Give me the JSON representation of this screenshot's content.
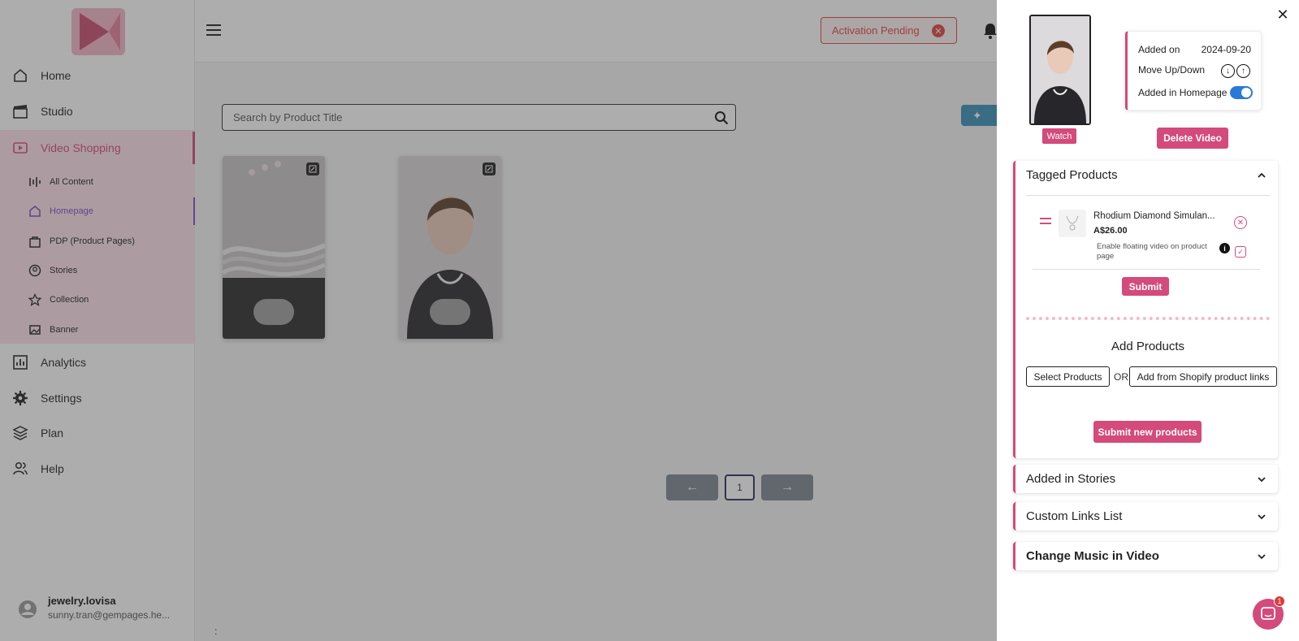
{
  "sidebar": {
    "items": [
      {
        "label": "Home",
        "icon": "home-icon"
      },
      {
        "label": "Studio",
        "icon": "clapperboard-icon"
      },
      {
        "label": "Video Shopping",
        "icon": "video-icon"
      },
      {
        "label": "Analytics",
        "icon": "bar-chart-icon"
      },
      {
        "label": "Settings",
        "icon": "gear-icon"
      },
      {
        "label": "Plan",
        "icon": "layers-icon"
      },
      {
        "label": "Help",
        "icon": "users-icon"
      }
    ],
    "sub_items": [
      {
        "label": "All Content",
        "icon": "sliders-icon"
      },
      {
        "label": "Homepage",
        "icon": "home-icon"
      },
      {
        "label": "PDP (Product Pages)",
        "icon": "bag-icon"
      },
      {
        "label": "Stories",
        "icon": "user-circle-icon"
      },
      {
        "label": "Collection",
        "icon": "star-icon"
      },
      {
        "label": "Banner",
        "icon": "image-icon"
      }
    ],
    "user": {
      "name": "jewelry.lovisa",
      "email": "sunny.tran@gempages.he..."
    }
  },
  "header": {
    "activation_label": "Activation Pending"
  },
  "main": {
    "search_placeholder": "Search by Product Title",
    "pagination": {
      "current": "1"
    },
    "colon": ":"
  },
  "drawer": {
    "watch_label": "Watch",
    "added_on_label": "Added on",
    "added_on_value": "2024-09-20",
    "move_label": "Move Up/Down",
    "homepage_label": "Added in Homepage",
    "homepage_enabled": true,
    "delete_label": "Delete Video",
    "tagged": {
      "title": "Tagged Products",
      "product_name": "Rhodium Diamond Simulan...",
      "product_price": "A$26.00",
      "floating_label": "Enable floating video on product page",
      "submit_label": "Submit"
    },
    "add": {
      "title": "Add Products",
      "select_label": "Select Products",
      "or_label": "OR",
      "shopify_label": "Add from Shopify product links",
      "submit_new_label": "Submit new products"
    },
    "sections": {
      "stories": "Added in Stories",
      "links": "Custom Links List",
      "music": "Change Music in Video"
    },
    "chat_badge": "1"
  },
  "colors": {
    "accent": "#d44a7a",
    "danger": "#e04444",
    "toggle_on": "#2a79d8",
    "purple": "#7a4cc4"
  }
}
